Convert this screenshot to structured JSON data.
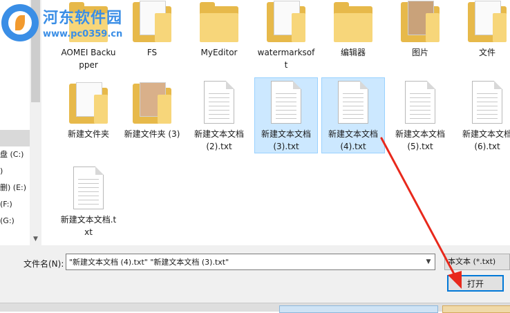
{
  "sidebar": {
    "drives": [
      {
        "label": "盘 (C:)"
      },
      {
        "label": ")"
      },
      {
        "label": "删) (E:)"
      },
      {
        "label": "(F:)"
      },
      {
        "label": "(G:)"
      }
    ]
  },
  "files": {
    "row1": [
      {
        "label": "AOMEI Backupper",
        "kind": "folder"
      },
      {
        "label": "FS",
        "kind": "folder"
      },
      {
        "label": "MyEditor",
        "kind": "folder"
      },
      {
        "label": "watermarksoft",
        "kind": "folder"
      },
      {
        "label": "编辑器",
        "kind": "folder"
      },
      {
        "label": "图片",
        "kind": "folder"
      },
      {
        "label": "文件",
        "kind": "folder"
      }
    ],
    "row2": [
      {
        "label": "新建文件夹",
        "kind": "folder"
      },
      {
        "label": "新建文件夹 (3)",
        "kind": "folder"
      },
      {
        "label": "新建文本文档 (2).txt",
        "kind": "text-file"
      },
      {
        "label": "新建文本文档 (3).txt",
        "kind": "text-file",
        "selected": true
      },
      {
        "label": "新建文本文档 (4).txt",
        "kind": "text-file",
        "selected": true
      },
      {
        "label": "新建文本文档 (5).txt",
        "kind": "text-file"
      },
      {
        "label": "新建文本文档 (6).txt",
        "kind": "text-file"
      }
    ],
    "row3": [
      {
        "label": "新建文本文档.txt",
        "kind": "text-file"
      }
    ]
  },
  "footer": {
    "filename_label": "文件名(N):",
    "filename_value": "\"新建文本文档 (4).txt\" \"新建文本文档 (3).txt\"",
    "filter_value": "本文本 (*.txt)",
    "open_button": "打开"
  },
  "watermark": {
    "title": "河东软件园",
    "url": "www.pc0359.cn"
  },
  "colors": {
    "selection_bg": "#cce8ff",
    "selection_border": "#99d1ff",
    "arrow": "#e8291c",
    "accent": "#0078d7"
  }
}
